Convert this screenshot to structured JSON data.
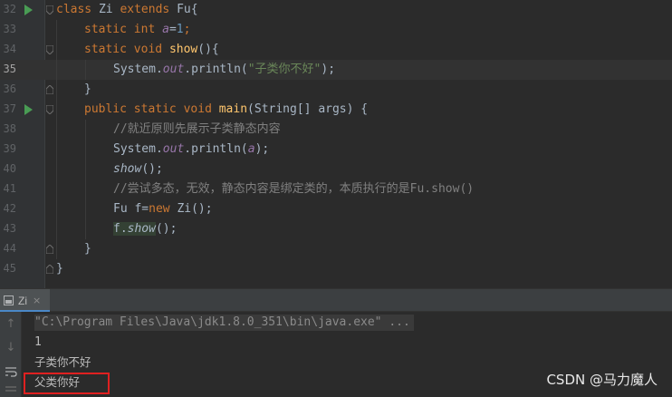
{
  "editor": {
    "lines": [
      {
        "num": "32",
        "text": "class Zi extends Fu{"
      },
      {
        "num": "33",
        "text": "static int a=1;"
      },
      {
        "num": "34",
        "text": "static void show(){"
      },
      {
        "num": "35",
        "text": "System.out.println(\"子类你不好\");"
      },
      {
        "num": "36",
        "text": "}"
      },
      {
        "num": "37",
        "text": "public static void main(String[] args) {"
      },
      {
        "num": "38",
        "text": "//就近原则先展示子类静态内容"
      },
      {
        "num": "39",
        "text": "System.out.println(a);"
      },
      {
        "num": "40",
        "text": "show();"
      },
      {
        "num": "41",
        "text": "//尝试多态，无效，静态内容是绑定类的，本质执行的是Fu.show()"
      },
      {
        "num": "42",
        "text": "Fu f=new Zi();"
      },
      {
        "num": "43",
        "text": "f.show();"
      },
      {
        "num": "44",
        "text": "}"
      },
      {
        "num": "45",
        "text": "}"
      }
    ],
    "tokens": {
      "l32": [
        "class",
        "Zi",
        "extends",
        "Fu",
        "{"
      ],
      "l33": [
        "static",
        "int",
        "a",
        "=",
        "1",
        ";"
      ],
      "l34": [
        "static",
        "void",
        "show",
        "(){"
      ],
      "l35": [
        "System.",
        "out",
        ".println(",
        "\"子类你不好\"",
        ");"
      ],
      "l36": [
        "}"
      ],
      "l37": [
        "public",
        "static",
        "void",
        "main",
        "(String[] args) {"
      ],
      "l38": [
        "//就近原则先展示子类静态内容"
      ],
      "l39": [
        "System.",
        "out",
        ".println(",
        "a",
        ");"
      ],
      "l40": [
        "show",
        "();"
      ],
      "l41": [
        "//尝试多态，无效，静态内容是绑定类的，本质执行的是Fu.show()"
      ],
      "l42": [
        "Fu f=",
        "new",
        " Zi();"
      ],
      "l43": [
        "f.",
        "show",
        "();"
      ],
      "l44": [
        "}"
      ],
      "l45": [
        "}"
      ]
    }
  },
  "run": {
    "tab_label": "Zi",
    "tab_close": "×",
    "output": [
      "\"C:\\Program Files\\Java\\jdk1.8.0_351\\bin\\java.exe\" ...",
      "1",
      "子类你不好",
      "父类你好"
    ]
  },
  "icons": {
    "run_gutter": "run-gutter-icon",
    "fold": "fold-icon",
    "tab": "run-config-icon",
    "up": "arrow-up-icon",
    "down": "arrow-down-icon",
    "wrap": "soft-wrap-icon"
  },
  "colors": {
    "keyword": "#cc7832",
    "method": "#ffc66d",
    "static_field": "#9876aa",
    "number": "#6897bb",
    "string": "#6a8759",
    "comment": "#808080",
    "highlight_box": "#e02020"
  },
  "watermark": "CSDN @马力魔人"
}
